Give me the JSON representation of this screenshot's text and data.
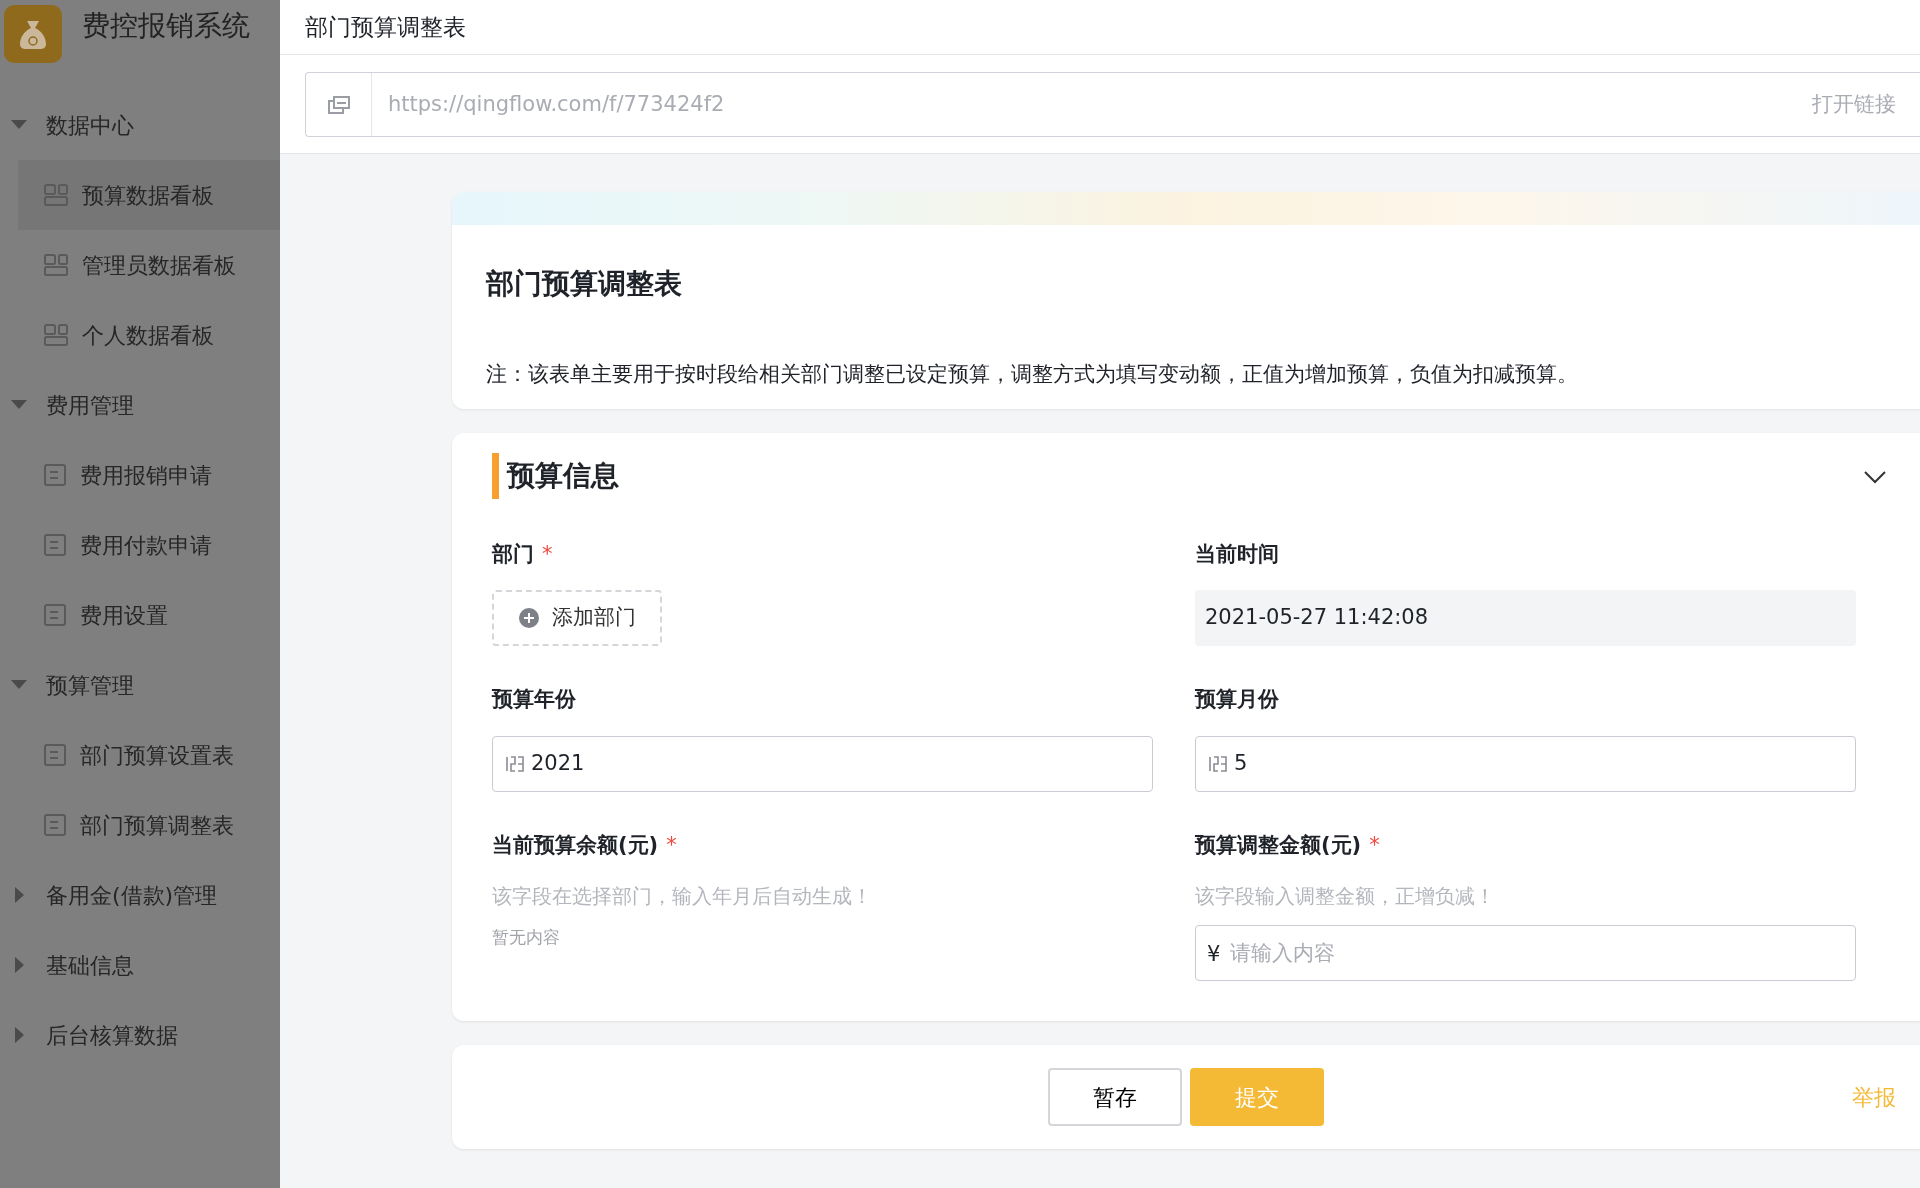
{
  "app_title": "费控报销系统",
  "sidebar": {
    "groups": [
      {
        "label": "数据中心",
        "expanded": true,
        "children": [
          {
            "label": "预算数据看板",
            "kind": "dashboard",
            "selected": true
          },
          {
            "label": "管理员数据看板",
            "kind": "dashboard",
            "selected": false
          },
          {
            "label": "个人数据看板",
            "kind": "dashboard",
            "selected": false
          }
        ]
      },
      {
        "label": "费用管理",
        "expanded": true,
        "children": [
          {
            "label": "费用报销申请",
            "kind": "form",
            "selected": false
          },
          {
            "label": "费用付款申请",
            "kind": "form",
            "selected": false
          },
          {
            "label": "费用设置",
            "kind": "form",
            "selected": false
          }
        ]
      },
      {
        "label": "预算管理",
        "expanded": true,
        "children": [
          {
            "label": "部门预算设置表",
            "kind": "form",
            "selected": false
          },
          {
            "label": "部门预算调整表",
            "kind": "form",
            "selected": false
          }
        ]
      },
      {
        "label": "备用金(借款)管理",
        "expanded": false
      },
      {
        "label": "基础信息",
        "expanded": false
      },
      {
        "label": "后台核算数据",
        "expanded": false
      }
    ]
  },
  "page_title": "部门预算调整表",
  "url_bar": {
    "url": "https://qingflow.com/f/773424f2",
    "action": "打开链接"
  },
  "form": {
    "title": "部门预算调整表",
    "note": "注：该表单主要用于按时段给相关部门调整已设定预算，调整方式为填写变动额，正值为增加预算，负值为扣减预算。"
  },
  "section": {
    "title": "预算信息",
    "expanded": true,
    "required_mark": "*",
    "fields": [
      {
        "kind": "member",
        "label": "部门",
        "required": true,
        "add_label": "添加部门"
      },
      {
        "kind": "readonly",
        "label": "当前时间",
        "required": false,
        "value": "2021-05-27 11:42:08"
      },
      {
        "kind": "number",
        "label": "预算年份",
        "required": false,
        "value": "2021"
      },
      {
        "kind": "number",
        "label": "预算月份",
        "required": false,
        "value": "5"
      },
      {
        "kind": "computed",
        "label": "当前预算余额(元)",
        "required": true,
        "hint": "该字段在选择部门，输入年月后自动生成！",
        "empty_text": "暂无内容"
      },
      {
        "kind": "currency",
        "label": "预算调整金额(元)",
        "required": true,
        "hint": "该字段输入调整金额，正增负减！",
        "prefix": "¥",
        "placeholder": "请输入内容"
      }
    ]
  },
  "buttons": {
    "save": "暂存",
    "submit": "提交",
    "report": "举报"
  }
}
